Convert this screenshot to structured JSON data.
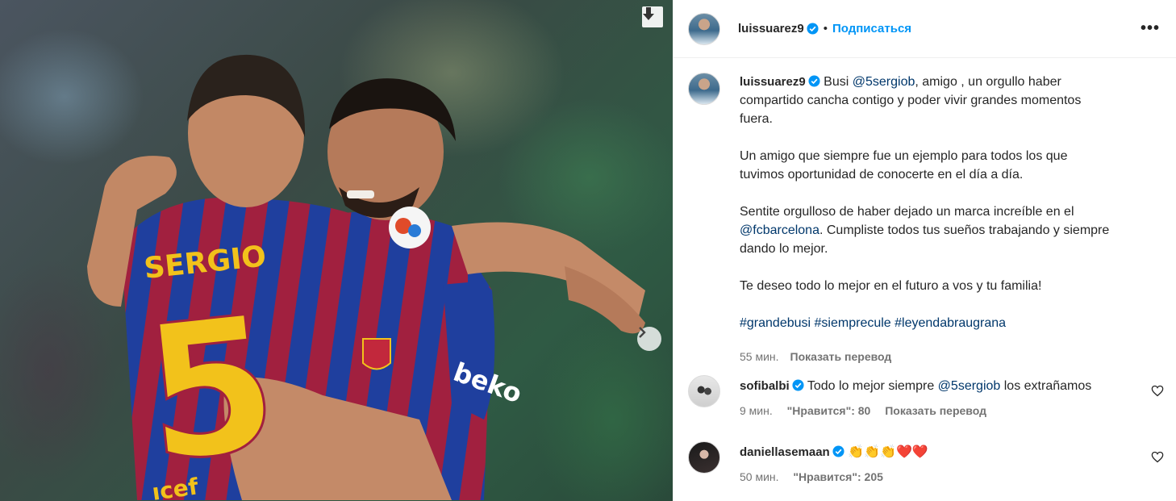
{
  "post": {
    "username": "luissuarez9",
    "follow_label": "Подписаться",
    "dot": "•",
    "more_label": "•••",
    "photo": {
      "jersey_name": "SERGIO",
      "jersey_number": "5",
      "sponsor": "beko",
      "sponsor2": "ıcef"
    }
  },
  "caption": {
    "username": "luissuarez9",
    "intro": "Busi ",
    "mention1": "@5sergiob",
    "intro_rest": ", amigo , un orgullo haber compartido cancha contigo y poder vivir grandes momentos fuera.",
    "para2": "Un amigo que siempre fue un ejemplo para todos los que tuvimos oportunidad de conocerte en el día a día.",
    "para3_start": "Sentite orgulloso de haber dejado un marca increíble en el ",
    "mention2": "@fcbarcelona",
    "para3_end": ". Cumpliste todos tus sueños trabajando y siempre dando lo mejor.",
    "para4": "Te deseo todo lo mejor en el futuro a vos y tu familia!",
    "hashtags": [
      "#grandebusi",
      "#siemprecule",
      "#leyendabraugrana"
    ],
    "time": "55 мин.",
    "translate": "Показать перевод"
  },
  "comments": [
    {
      "username": "sofibalbi",
      "text_start": "Todo lo mejor siempre ",
      "mention": "@5sergiob",
      "text_end": " los extrañamos",
      "time": "9 мин.",
      "likes": "\"Нравится\": 80",
      "translate": "Показать перевод"
    },
    {
      "username": "daniellasemaan",
      "emoji": "👏👏👏❤️❤️",
      "time": "50 мин.",
      "likes": "\"Нравится\": 205"
    }
  ],
  "icons": {
    "download": "download-arrow-icon",
    "next": "chevron-right-icon",
    "verified": "verified-badge-icon",
    "like": "heart-icon",
    "more": "more-dots-icon"
  },
  "colors": {
    "accent": "#0095f6",
    "link": "#00376b",
    "muted": "#737373",
    "verified": "#0095f6"
  }
}
